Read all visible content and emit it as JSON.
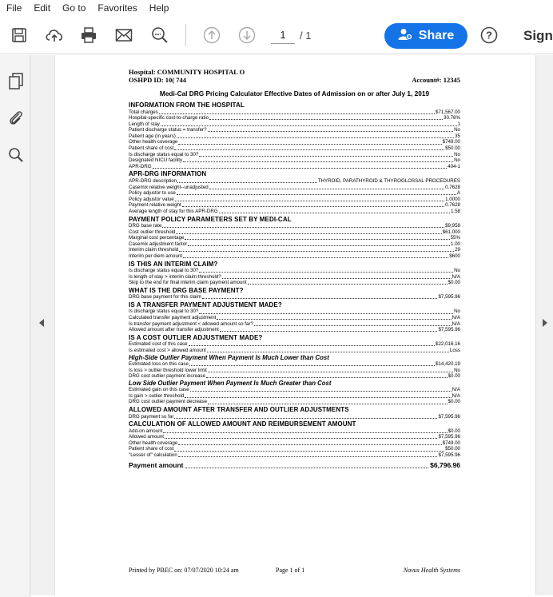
{
  "menu": [
    "File",
    "Edit",
    "Go to",
    "Favorites",
    "Help"
  ],
  "toolbar": {
    "page_current": "1",
    "page_total": "/ 1",
    "share_label": "Share",
    "sign_label": "Sign",
    "icons": [
      "save-icon",
      "upload-icon",
      "print-icon",
      "mail-icon",
      "zoom-search-icon",
      "page-up-icon",
      "page-down-icon",
      "help-icon"
    ]
  },
  "sidebar": {
    "icons": [
      "pages-icon",
      "attachment-icon",
      "search-icon"
    ]
  },
  "colors": {
    "accent": "#1473e6"
  },
  "document": {
    "hospital": "Hospital: COMMUNITY HOSPITAL O",
    "oshpd": "OSHPD ID: 10(      744",
    "account": "Account#: 12345",
    "title": "Medi-Cal DRG Pricing Calculator Effective Dates of Admission on or after July 1, 2019",
    "sections": [
      {
        "heading": "INFORMATION FROM THE HOSPITAL",
        "rows": [
          {
            "label": "Total charges",
            "value": "$71,567.00"
          },
          {
            "label": "Hospital-specific cost-to-charge ratio",
            "value": "30.76%"
          },
          {
            "label": "Length of stay",
            "value": "1"
          },
          {
            "label": "Patient discharge status = transfer?",
            "value": "No"
          },
          {
            "label": "Patient age (in years)",
            "value": "35"
          },
          {
            "label": "Other health coverage",
            "value": "$749.00"
          },
          {
            "label": "Patient share of cost",
            "value": "$50.00"
          },
          {
            "label": "Is discharge status equal to 30?",
            "value": "No"
          },
          {
            "label": "Designated NICU facility",
            "value": "No"
          },
          {
            "label": "APR-DRG",
            "value": "404-1"
          }
        ]
      },
      {
        "heading": "APR-DRG INFORMATION",
        "rows": [
          {
            "label": "APR-DRG description",
            "value": "THYROID, PARATHYROID & THYROGLOSSAL PROCEDURES"
          },
          {
            "label": "Casemix relative weight--unadjusted",
            "value": "0.7628"
          },
          {
            "label": "Policy adjustor to use",
            "value": "A"
          },
          {
            "label": "Policy adjustor value",
            "value": "1.0000"
          },
          {
            "label": "Payment relative weight",
            "value": "0.7628"
          },
          {
            "label": "Average length of stay for this APR-DRG",
            "value": "1.58"
          }
        ]
      },
      {
        "heading": "PAYMENT POLICY PARAMETERS SET BY MEDI-CAL",
        "rows": [
          {
            "label": "DRG base rate",
            "value": "$9,958"
          },
          {
            "label": "Cost outlier threshold",
            "value": "$61,000"
          },
          {
            "label": "Marginal cost percentage",
            "value": "55%"
          },
          {
            "label": "Casemix adjustment factor",
            "value": "1.00"
          },
          {
            "label": "Interim claim threshold",
            "value": "29"
          },
          {
            "label": "Interim per diem amount",
            "value": "$600"
          }
        ]
      },
      {
        "heading": "IS THIS AN INTERIM CLAIM?",
        "rows": [
          {
            "label": "Is discharge status equal to 30?",
            "value": "No"
          },
          {
            "label": "Is length of stay > interim claim threshold?",
            "value": "N/A"
          },
          {
            "label": "Skip to the end for final interim claim payment amount",
            "value": "$0.00"
          }
        ]
      },
      {
        "heading": "WHAT IS THE DRG BASE PAYMENT?",
        "rows": [
          {
            "label": "DRG base payment for this claim",
            "value": "$7,595.96"
          }
        ]
      },
      {
        "heading": "IS A TRANSFER PAYMENT ADJUSTMENT MADE?",
        "rows": [
          {
            "label": "Is discharge status equal to 30?",
            "value": "No"
          },
          {
            "label": "Calculated transfer payment adjustment",
            "value": "N/A"
          },
          {
            "label": "Is transfer payment adjustment < allowed amount so far?",
            "value": "N/A"
          },
          {
            "label": "Allowed amount after transfer adjustment",
            "value": "$7,595.96"
          }
        ]
      },
      {
        "heading": "IS A COST OUTLIER ADJUSTMENT MADE?",
        "rows": [
          {
            "label": "Estimated cost of this case",
            "value": "$22,016.16"
          },
          {
            "label": "Is estimated cost > allowed amount",
            "value": "Loss"
          }
        ]
      },
      {
        "subheading": "High-Side Outlier Payment When Payment Is Much Lower than Cost",
        "rows": [
          {
            "label": "Estimated loss on this case",
            "value": "$14,420.19"
          },
          {
            "label": "Is loss > outlier threshold lower limit",
            "value": "No"
          },
          {
            "label": "DRG cost outlier payment increase",
            "value": "$0.00"
          }
        ]
      },
      {
        "subheading": "Low Side Outlier Payment When Payment Is Much Greater than Cost",
        "rows": [
          {
            "label": "Estimated gain on this case",
            "value": "N/A"
          },
          {
            "label": "Is gain > outlier threshold",
            "value": "N/A"
          },
          {
            "label": "DRG cost outlier payment decrease",
            "value": "$0.00"
          }
        ]
      },
      {
        "heading": "ALLOWED AMOUNT AFTER TRANSFER AND OUTLIER ADJUSTMENTS",
        "rows": [
          {
            "label": "DRG payment so far",
            "value": "$7,595.96"
          }
        ]
      },
      {
        "heading": "CALCULATION OF ALLOWED AMOUNT AND REIMBURSEMENT AMOUNT",
        "rows": [
          {
            "label": "Add-on amount",
            "value": "$0.00"
          },
          {
            "label": "Allowed amount",
            "value": "$7,595.96"
          },
          {
            "label": "Other health coverage",
            "value": "$749.00"
          },
          {
            "label": "Patient share of cost",
            "value": "$50.00"
          },
          {
            "label": "\"Lesser of\" calculation",
            "value": "$7,595.96"
          }
        ]
      }
    ],
    "payment_label": "Payment amount",
    "payment_value": "$6,796.96",
    "footer_printed": "Printed by PBEC on: 07/07/2020 10:24 am",
    "footer_page": "Page 1 of 1",
    "footer_brand": "Novus Health Systems"
  }
}
